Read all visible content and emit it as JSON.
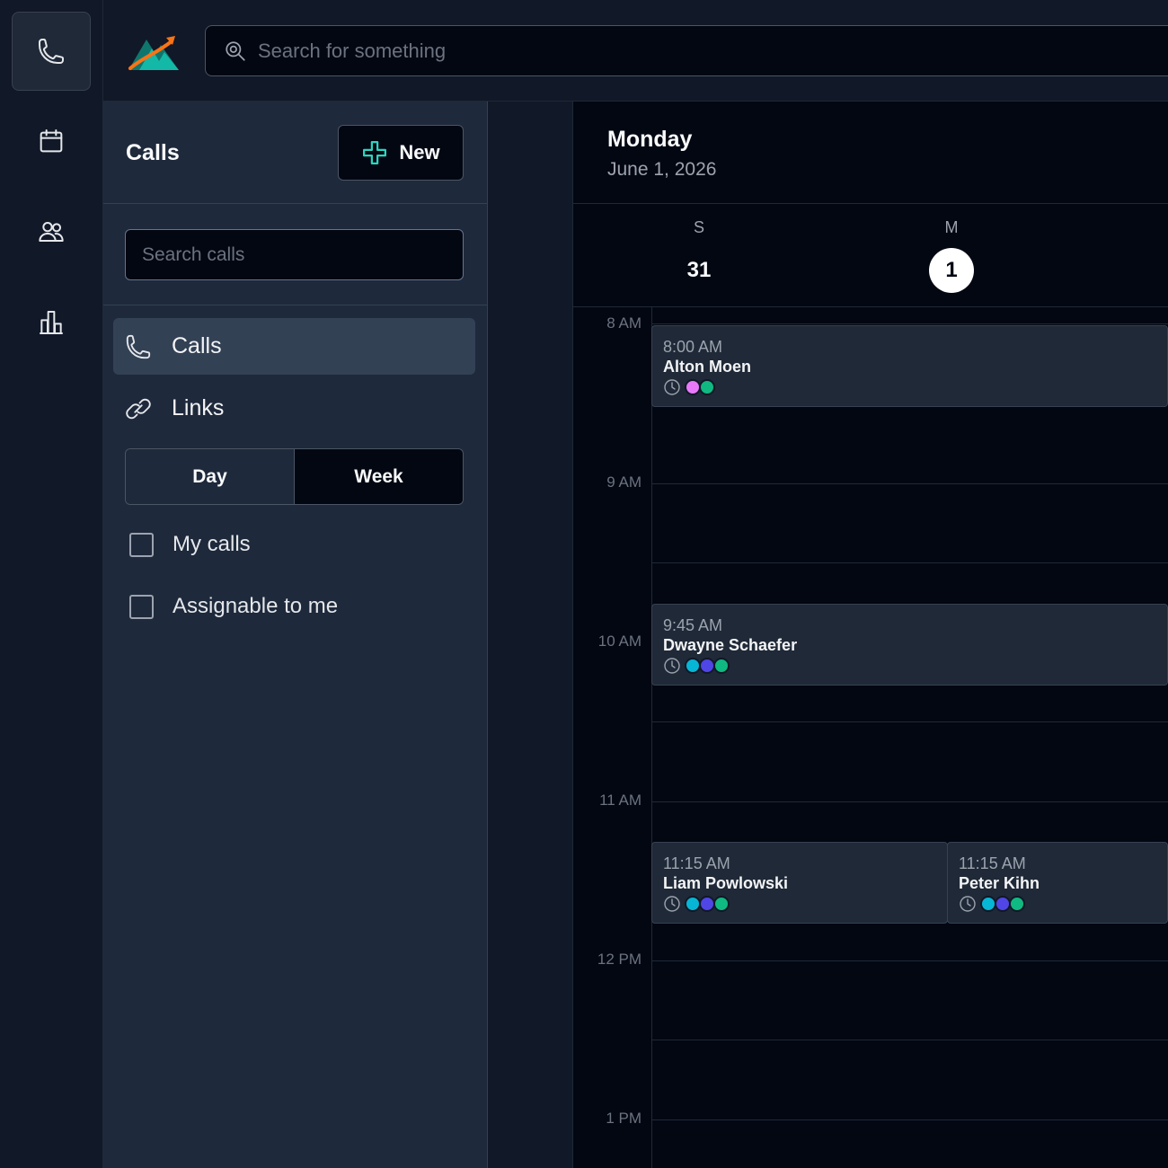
{
  "rail": {
    "items": [
      {
        "icon": "phone-icon",
        "active": true
      },
      {
        "icon": "calendar-icon",
        "active": false
      },
      {
        "icon": "users-icon",
        "active": false
      },
      {
        "icon": "chart-icon",
        "active": false
      }
    ]
  },
  "topbar": {
    "logo": "mountain-logo",
    "search_placeholder": "Search for something"
  },
  "panel": {
    "title": "Calls",
    "new_button": "New",
    "search_placeholder": "Search calls",
    "nav": [
      {
        "label": "Calls",
        "icon": "phone-icon",
        "active": true
      },
      {
        "label": "Links",
        "icon": "link-icon",
        "active": false
      }
    ],
    "view_toggle": {
      "day": "Day",
      "week": "Week",
      "selected": "Week"
    },
    "filters": [
      {
        "label": "My calls",
        "checked": false
      },
      {
        "label": "Assignable to me",
        "checked": false
      }
    ]
  },
  "calendar": {
    "weekday": "Monday",
    "date": "June 1, 2026",
    "days": [
      {
        "letter": "S",
        "number": "31",
        "today": false
      },
      {
        "letter": "M",
        "number": "1",
        "today": true
      }
    ],
    "hours": [
      "8 AM",
      "9 AM",
      "10 AM",
      "11 AM",
      "12 PM",
      "1 PM"
    ],
    "events": [
      {
        "time": "8:00 AM",
        "name": "Alton Moen",
        "dots": [
          "#e879f9",
          "#10b981"
        ]
      },
      {
        "time": "9:45 AM",
        "name": "Dwayne Schaefer",
        "dots": [
          "#06b6d4",
          "#4f46e5",
          "#10b981"
        ]
      },
      {
        "time": "11:15 AM",
        "name": "Liam Powlowski",
        "dots": [
          "#06b6d4",
          "#4f46e5",
          "#10b981"
        ]
      },
      {
        "time": "11:15 AM",
        "name": "Peter Kihn",
        "dots": [
          "#06b6d4",
          "#4f46e5",
          "#10b981"
        ]
      }
    ]
  },
  "colors": {
    "accent": "#2dd4bf",
    "background": "#030712",
    "panel": "#1e293b"
  }
}
